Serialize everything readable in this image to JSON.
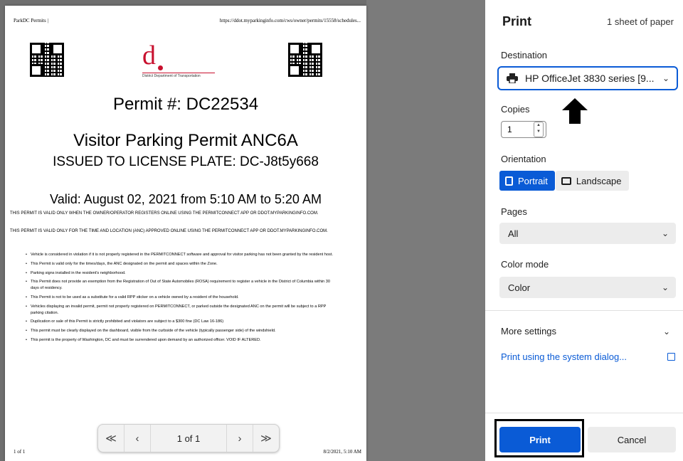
{
  "preview": {
    "header_left": "ParkDC Permits |",
    "header_right": "https://ddot.myparkinginfo.com/cws/owner/permits/15558/schedules...",
    "logo_letter": "d",
    "logo_subtitle": "District Department of Transportation",
    "permit_number": "Permit #: DC22534",
    "permit_title": "Visitor Parking Permit ANC6A",
    "issued_to": "ISSUED TO LICENSE PLATE: DC-J8t5y668",
    "valid": "Valid: August 02, 2021 from 5:10 AM to 5:20 AM",
    "notice_1": "THIS PERMIT IS VALID ONLY WHEN THE OWNER/OPERATOR REGISTERS ONLINE USING THE PERMITCONNECT APP OR DDOT.MYPARKINGINFO.COM.",
    "notice_2": "THIS PERMIT IS VALID ONLY FOR THE TIME AND LOCATION (ANC) APPROVED ONLINE USING THE PERMITCONNECT APP OR DDOT.MYPARKINGINFO.COM.",
    "bullets": [
      "Vehicle is considered in violation if it is not properly registered in the PERMITCONNECT software and approval for visitor parking has not been granted by the resident host.",
      "This Permit is valid only for the times/days, the ANC designated on the permit and spaces within the Zone.",
      "Parking signs installed in the resident's neighborhood.",
      "This Permit does not provide an exemption from the Registration of Out of State Automobiles (ROSA) requirement to register a vehicle in the District of Columbia within 30 days of residency.",
      "This Permit is not to be used as a substitute for a valid RPP sticker on a vehicle owned by a resident of the household.",
      "Vehicles displaying an invalid permit, permit not properly registered on PERMITCONNECT, or parked outside the designated ANC on the permit will be subject to a RPP parking citation.",
      "Duplication or sale of this Permit is strictly prohibited and violators are subject to a $300 fine (DC Law 16-186)",
      "This permit must be clearly displayed on the dashboard, visible from the curbside of the vehicle (typically passenger side) of the windshield.",
      "This permit is the property of Washington, DC and must be surrendered upon demand by an authorized officer. VOID IF ALTERED."
    ],
    "footer_left": "1 of 1",
    "footer_right": "8/2/2021, 5:10 AM",
    "pager": {
      "first": "≪",
      "prev": "‹",
      "page": "1 of 1",
      "next": "›",
      "last": "≫"
    }
  },
  "panel": {
    "title": "Print",
    "sheets": "1 sheet of paper",
    "destination_label": "Destination",
    "destination_value": "HP OfficeJet 3830 series [9...",
    "copies_label": "Copies",
    "copies_value": "1",
    "orientation_label": "Orientation",
    "portrait": "Portrait",
    "landscape": "Landscape",
    "pages_label": "Pages",
    "pages_value": "All",
    "color_label": "Color mode",
    "color_value": "Color",
    "more_settings": "More settings",
    "system_dialog": "Print using the system dialog...",
    "print_button": "Print",
    "cancel_button": "Cancel"
  },
  "colors": {
    "accent": "#0a5bd6",
    "logo_red": "#c8102e",
    "preview_background": "#6f6f6f"
  }
}
